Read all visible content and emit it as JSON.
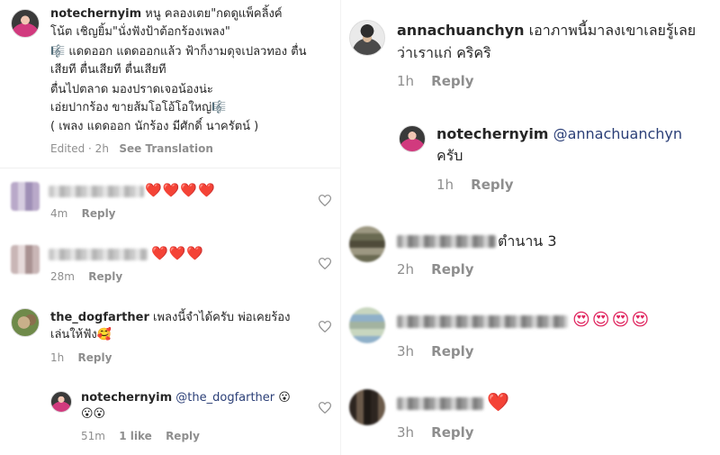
{
  "left": {
    "caption": {
      "username": "notechernyim",
      "lines": [
        "หนู คลองเตย\"กดดูแพ็คลิ้งค์",
        "โน้ต เชิญยิ้ม\"นั่งฟังป้าต้อกร้องเพลง\"",
        "🎼 แดดออก แดดออกแล้ว ฟ้าก็งามดุจเปลวทอง ตื่น",
        "เสียที ตื่นเสียที ตื่นเสียที",
        "ตื่นไปตลาด มองปราดเจอน้องน่ะ",
        "เอ่ยปากร้อง ขายส้มโอโอ้โอใหญ่🎼",
        "( เพลง แดดออก นักร้อง มีศักดิ์ นาครัตน์ )"
      ],
      "edited": "Edited · 2h",
      "see_translation": "See Translation"
    },
    "comments": [
      {
        "emoji": "❤️❤️❤️❤️",
        "time": "4m",
        "reply": "Reply"
      },
      {
        "emoji": "❤️❤️❤️",
        "time": "28m",
        "reply": "Reply"
      },
      {
        "username": "the_dogfarther",
        "line1": "เพลงนี้จำได้ครับ พ่อเคยร้อง",
        "line2": "เล่นให้ฟัง🥰",
        "time": "1h",
        "reply": "Reply"
      },
      {
        "username": "notechernyim",
        "mention": "@the_dogfarther",
        "emoji1": "😮",
        "line2": "😮😮",
        "time": "51m",
        "likes": "1 like",
        "reply": "Reply"
      }
    ]
  },
  "right": {
    "comments": [
      {
        "username": "annachuanchyn",
        "line1": "เอาภาพนี้มาลงเขาเลยรู้เลย",
        "line2": "ว่าเราแก่  คริคริ",
        "time": "1h",
        "reply": "Reply"
      },
      {
        "username": "notechernyim",
        "mention": "@annachuanchyn",
        "line2": "ครับ",
        "time": "1h",
        "reply": "Reply"
      },
      {
        "text": "ตำนาน 3",
        "time": "2h",
        "reply": "Reply"
      },
      {
        "emoji": "😍😍😍😍",
        "time": "3h",
        "reply": "Reply"
      },
      {
        "emoji": "❤️",
        "time": "3h",
        "reply": "Reply"
      }
    ]
  },
  "colors": {
    "heart_red": "#e0245e",
    "meta_gray": "#8e8e8e",
    "mention_blue": "#2b3f77"
  }
}
